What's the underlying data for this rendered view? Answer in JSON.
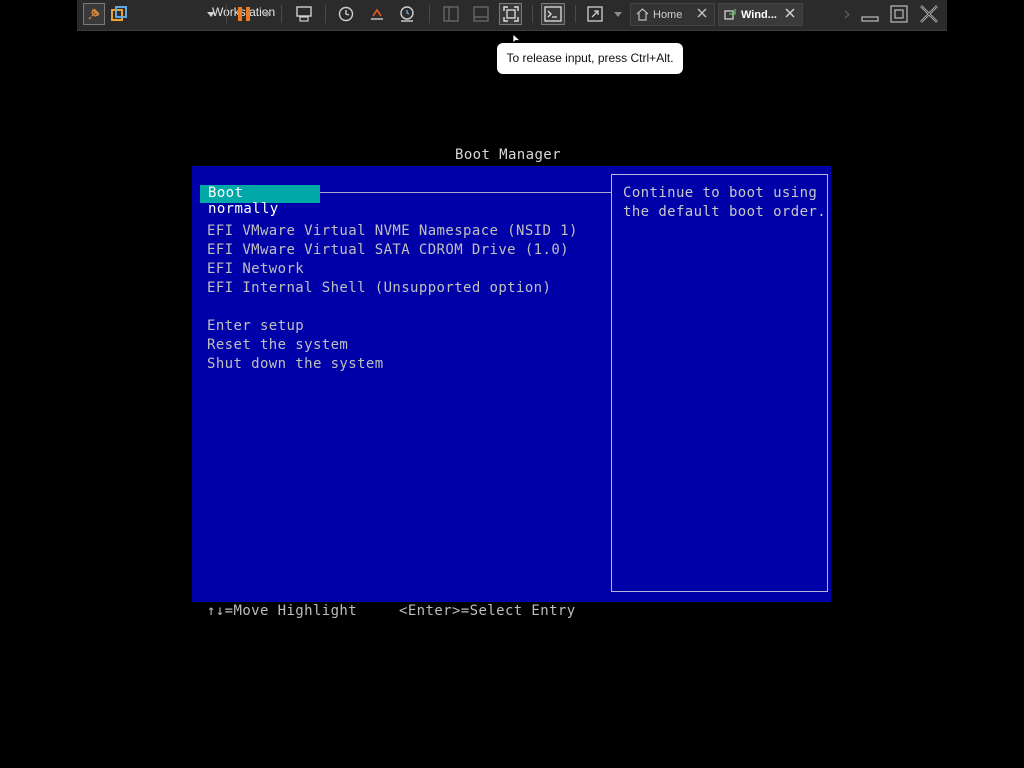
{
  "toolbar": {
    "library_label": "Workstation",
    "tabs": [
      {
        "label": "Home"
      },
      {
        "label": "Wind..."
      }
    ]
  },
  "tooltip": {
    "text": "To release input, press Ctrl+Alt."
  },
  "boot_manager": {
    "title": "Boot Manager",
    "selected_item": "Boot normally",
    "items_group1": [
      "EFI VMware Virtual NVME Namespace (NSID 1)",
      "EFI VMware Virtual SATA CDROM Drive (1.0)",
      "EFI Network",
      "EFI Internal Shell (Unsupported option)"
    ],
    "items_group2": [
      "Enter setup",
      "Reset the system",
      "Shut down the system"
    ],
    "help_text": "Continue to boot using\nthe default boot order.",
    "footer_move": "↑↓=Move Highlight",
    "footer_select": "<Enter>=Select Entry"
  },
  "colors": {
    "panel_bg": "#0000a8",
    "highlight_bg": "#00a8a8",
    "toolbar_bg": "#2b2b2b",
    "pause_accent": "#f07820"
  }
}
